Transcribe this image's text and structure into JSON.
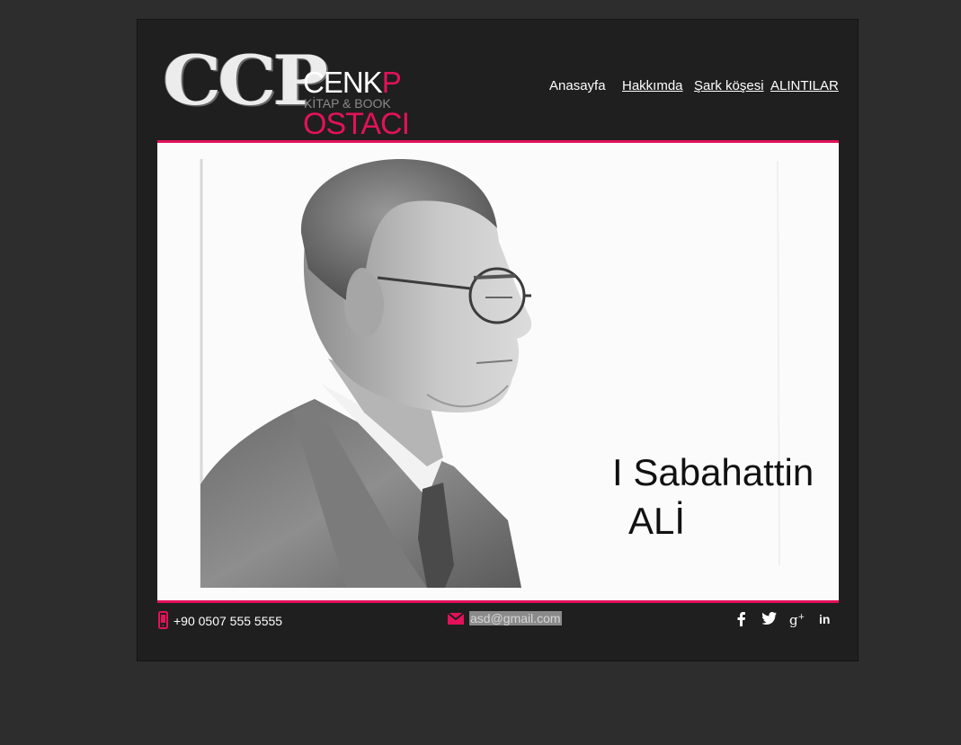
{
  "logo": {
    "mark": "CCP",
    "line1_main": "CENK",
    "line1_accent": "P",
    "subtitle": "KİTAP & BOOK",
    "line2": "OSTACI"
  },
  "nav": {
    "items": [
      {
        "label": "Anasayfa"
      },
      {
        "label": "Hakkımda"
      },
      {
        "label": "Şark köşesi"
      },
      {
        "label": "ALINTILAR"
      }
    ]
  },
  "hero": {
    "caption_line1": "I Sabahattin",
    "caption_line2": "ALİ"
  },
  "footer": {
    "phone": "+90 0507 555 5555",
    "email": "asd@gmail.com",
    "social": [
      {
        "icon": "facebook-icon",
        "glyph": "f"
      },
      {
        "icon": "twitter-icon",
        "glyph": "twitter"
      },
      {
        "icon": "google-plus-icon",
        "glyph": "g+"
      },
      {
        "icon": "linkedin-icon",
        "glyph": "in"
      }
    ]
  },
  "colors": {
    "accent": "#e2125a",
    "page_bg": "#2d2d2d",
    "panel_bg": "#1f1f1f",
    "text": "#ffffff"
  }
}
